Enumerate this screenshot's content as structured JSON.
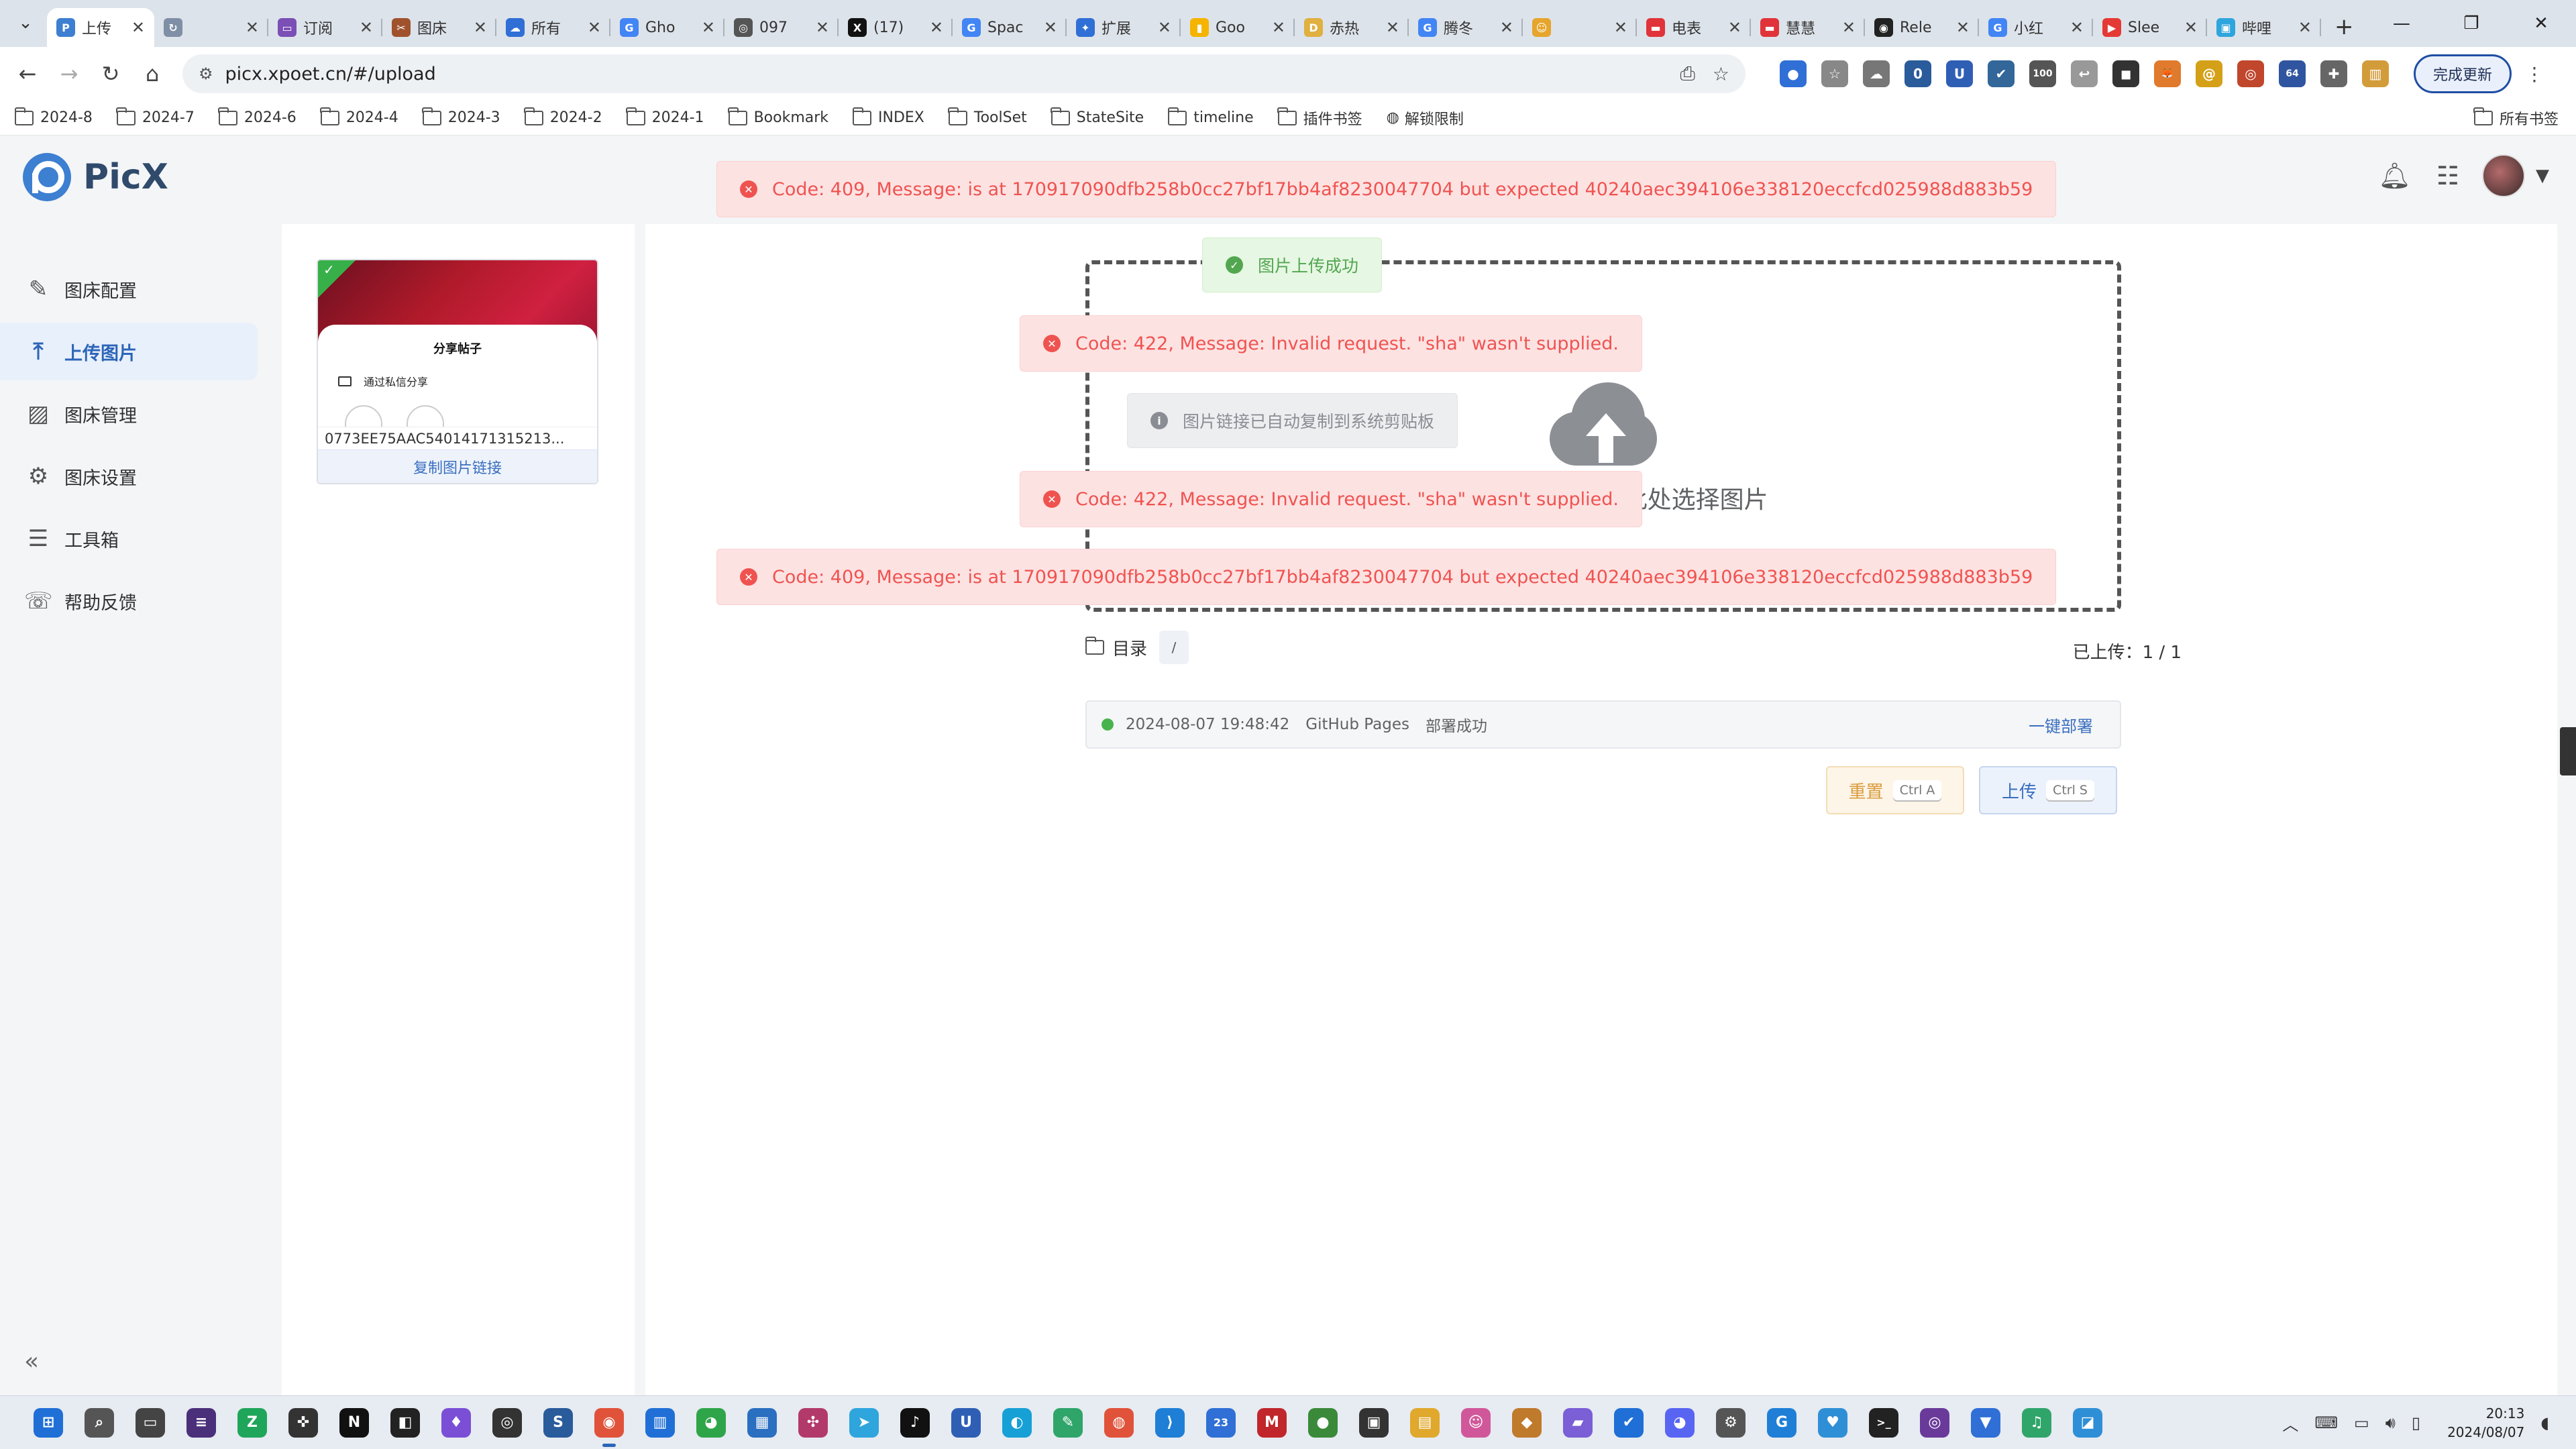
{
  "browser": {
    "tabs": [
      {
        "label": "上传",
        "color": "#3d7fd1",
        "glyph": "P"
      },
      {
        "label": "",
        "color": "#7f8fa6",
        "glyph": "↻"
      },
      {
        "label": "订阅",
        "color": "#7b4fb5",
        "glyph": "▭"
      },
      {
        "label": "图床",
        "color": "#a0522d",
        "glyph": "✂"
      },
      {
        "label": "所有",
        "color": "#2f6fd6",
        "glyph": "☁"
      },
      {
        "label": "Gho",
        "color": "#4285f4",
        "glyph": "G"
      },
      {
        "label": "097",
        "color": "#555555",
        "glyph": "◎"
      },
      {
        "label": "(17)",
        "color": "#111111",
        "glyph": "X"
      },
      {
        "label": "Spac",
        "color": "#4285f4",
        "glyph": "G"
      },
      {
        "label": "扩展",
        "color": "#2f6fd6",
        "glyph": "✦"
      },
      {
        "label": "Goo",
        "color": "#f5b400",
        "glyph": "▮"
      },
      {
        "label": "赤热",
        "color": "#e0b040",
        "glyph": "D"
      },
      {
        "label": "腾冬",
        "color": "#4285f4",
        "glyph": "G"
      },
      {
        "label": "",
        "color": "#e6a52c",
        "glyph": "☺"
      },
      {
        "label": "电表",
        "color": "#e0343a",
        "glyph": "▬"
      },
      {
        "label": "慧慧",
        "color": "#e0343a",
        "glyph": "▬"
      },
      {
        "label": "Rele",
        "color": "#222222",
        "glyph": "◉"
      },
      {
        "label": "小红",
        "color": "#4285f4",
        "glyph": "G"
      },
      {
        "label": "Slee",
        "color": "#e53935",
        "glyph": "▶"
      },
      {
        "label": "哔哩",
        "color": "#2fa5dd",
        "glyph": "▣"
      }
    ],
    "url": "picx.xpoet.cn/#/upload",
    "update_button": "完成更新",
    "extensions": [
      {
        "color": "#2f6fd6",
        "glyph": "●"
      },
      {
        "color": "#888888",
        "glyph": "☆"
      },
      {
        "color": "#777777",
        "glyph": "☁"
      },
      {
        "color": "#2a5b9b",
        "glyph": "0"
      },
      {
        "color": "#2f5fb5",
        "glyph": "U"
      },
      {
        "color": "#336699",
        "glyph": "✔"
      },
      {
        "color": "#555555",
        "glyph": "100"
      },
      {
        "color": "#999999",
        "glyph": "↩"
      },
      {
        "color": "#333333",
        "glyph": "◼"
      },
      {
        "color": "#e07a2c",
        "glyph": "🦊"
      },
      {
        "color": "#d4a017",
        "glyph": "@"
      },
      {
        "color": "#c0462c",
        "glyph": "◎"
      },
      {
        "color": "#3055a0",
        "glyph": "64"
      },
      {
        "color": "#666666",
        "glyph": "✚"
      },
      {
        "color": "#d39c3a",
        "glyph": "▥"
      }
    ],
    "bookmarks": [
      "2024-8",
      "2024-7",
      "2024-6",
      "2024-4",
      "2024-3",
      "2024-2",
      "2024-1",
      "Bookmark",
      "INDEX",
      "ToolSet",
      "StateSite",
      "timeline",
      "插件书签"
    ],
    "bookmark_extra": "解锁限制",
    "all_bookmarks": "所有书签"
  },
  "app": {
    "name": "PicX",
    "nav": [
      {
        "label": "图床配置",
        "icon": "✎",
        "active": false
      },
      {
        "label": "上传图片",
        "icon": "⤒",
        "active": true
      },
      {
        "label": "图床管理",
        "icon": "▨",
        "active": false
      },
      {
        "label": "图床设置",
        "icon": "⚙",
        "active": false
      },
      {
        "label": "工具箱",
        "icon": "☰",
        "active": false
      },
      {
        "label": "帮助反馈",
        "icon": "☏",
        "active": false
      }
    ],
    "image_card": {
      "thumb_title": "分享帖子",
      "thumb_row": "通过私信分享",
      "filename": "0773EE75AAC54014171315213...",
      "copy_link": "复制图片链接"
    },
    "dropzone_hint": "/ 点击此处选择图片",
    "dir_label": "目录",
    "dir_path": "/",
    "uploaded": "已上传：1 / 1",
    "deploy": {
      "time": "2024-08-07 19:48:42",
      "target": "GitHub Pages",
      "status": "部署成功",
      "action": "一键部署"
    },
    "reset_button": "重置",
    "reset_shortcut": "Ctrl A",
    "upload_button": "上传",
    "upload_shortcut": "Ctrl S"
  },
  "toasts": {
    "err409_top": "Code: 409, Message: is at 170917090dfb258b0cc27bf17bb4af8230047704 but expected 40240aec394106e338120eccfcd025988d883b59",
    "success": "图片上传成功",
    "err422_a": "Code: 422, Message: Invalid request. \"sha\" wasn't supplied.",
    "info": "图片链接已自动复制到系统剪贴板",
    "err422_b": "Code: 422, Message: Invalid request. \"sha\" wasn't supplied.",
    "err409_bottom": "Code: 409, Message: is at 170917090dfb258b0cc27bf17bb4af8230047704 but expected 40240aec394106e338120eccfcd025988d883b59"
  },
  "taskbar": {
    "icons": [
      {
        "color": "#1f6fd6",
        "glyph": "⊞"
      },
      {
        "color": "#555555",
        "glyph": "⌕"
      },
      {
        "color": "#444444",
        "glyph": "▭"
      },
      {
        "color": "#4a2f7a",
        "glyph": "≡"
      },
      {
        "color": "#1fa65a",
        "glyph": "Z"
      },
      {
        "color": "#333333",
        "glyph": "✜"
      },
      {
        "color": "#111111",
        "glyph": "N"
      },
      {
        "color": "#222222",
        "glyph": "◧"
      },
      {
        "color": "#7a4fd6",
        "glyph": "♦"
      },
      {
        "color": "#333333",
        "glyph": "◎"
      },
      {
        "color": "#2a5b9b",
        "glyph": "S"
      },
      {
        "color": "#e0533a",
        "glyph": "◉"
      },
      {
        "color": "#1f6fd6",
        "glyph": "▥"
      },
      {
        "color": "#2fa54a",
        "glyph": "◕"
      },
      {
        "color": "#2a6fc0",
        "glyph": "▦"
      },
      {
        "color": "#b23a6a",
        "glyph": "✣"
      },
      {
        "color": "#2fa5dd",
        "glyph": "➤"
      },
      {
        "color": "#111111",
        "glyph": "♪"
      },
      {
        "color": "#2f5fb5",
        "glyph": "U"
      },
      {
        "color": "#17a0d6",
        "glyph": "◐"
      },
      {
        "color": "#2fa56a",
        "glyph": "✎"
      },
      {
        "color": "#e0533a",
        "glyph": "◍"
      },
      {
        "color": "#1f7fd6",
        "glyph": "⟩"
      },
      {
        "color": "#2f6fd6",
        "glyph": "23"
      },
      {
        "color": "#c0262c",
        "glyph": "M"
      },
      {
        "color": "#3a8a3a",
        "glyph": "●"
      },
      {
        "color": "#333333",
        "glyph": "▣"
      },
      {
        "color": "#e0a82c",
        "glyph": "▤"
      },
      {
        "color": "#d0589a",
        "glyph": "☺"
      },
      {
        "color": "#c07a2c",
        "glyph": "◆"
      },
      {
        "color": "#7a5fd6",
        "glyph": "▰"
      },
      {
        "color": "#1f6fd6",
        "glyph": "✔"
      },
      {
        "color": "#5865f2",
        "glyph": "◕"
      },
      {
        "color": "#555555",
        "glyph": "⚙"
      },
      {
        "color": "#1f7fd6",
        "glyph": "G"
      },
      {
        "color": "#2f8fd6",
        "glyph": "♥"
      },
      {
        "color": "#222222",
        "glyph": ">_"
      },
      {
        "color": "#6a3a9a",
        "glyph": "◎"
      },
      {
        "color": "#2f6fd6",
        "glyph": "▼"
      },
      {
        "color": "#2fa56a",
        "glyph": "♫"
      },
      {
        "color": "#2f8fd6",
        "glyph": "◪"
      }
    ],
    "time": "20:13",
    "date": "2024/08/07"
  }
}
